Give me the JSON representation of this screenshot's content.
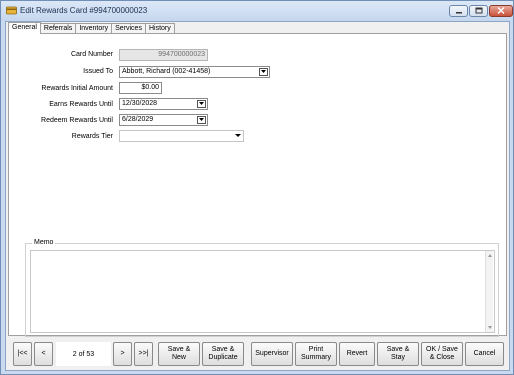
{
  "window": {
    "title": "Edit Rewards Card #994700000023"
  },
  "tabs": [
    {
      "label": "General",
      "active": true
    },
    {
      "label": "Referrals",
      "active": false
    },
    {
      "label": "Inventory",
      "active": false
    },
    {
      "label": "Services",
      "active": false
    },
    {
      "label": "History",
      "active": false
    }
  ],
  "form": {
    "card_number": {
      "label": "Card Number",
      "value": "994700000023"
    },
    "issued_to": {
      "label": "Issued To",
      "value": "Abbott, Richard (002-41458)"
    },
    "initial_amount": {
      "label": "Rewards Initial Amount",
      "value": "$0.00"
    },
    "earns_until": {
      "label": "Earns Rewards Until",
      "value": "12/30/2028"
    },
    "redeem_until": {
      "label": "Redeem Rewards Until",
      "value": "6/28/2029"
    },
    "tier": {
      "label": "Rewards Tier",
      "value": ""
    }
  },
  "memo": {
    "label": "Memo",
    "value": ""
  },
  "pager": {
    "first": "|<<",
    "prev": "<",
    "position": "2 of 53",
    "next": ">",
    "last": ">>|"
  },
  "buttons": {
    "save_new": "Save &\nNew",
    "save_duplicate": "Save &\nDuplicate",
    "supervisor": "Supervisor",
    "print_summary": "Print\nSummary",
    "revert": "Revert",
    "save_stay": "Save &\nStay",
    "ok_save_close": "OK / Save\n& Close",
    "cancel": "Cancel"
  },
  "icons": {
    "app": "rewards-card-icon",
    "minimize": "minimize-icon",
    "maximize": "maximize-icon",
    "close": "close-icon"
  },
  "colors": {
    "window_frame": "#c9daf0",
    "close_button": "#c9513a"
  }
}
